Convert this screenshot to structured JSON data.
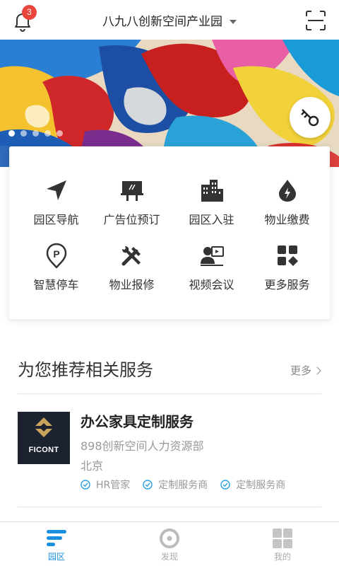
{
  "header": {
    "notification_count": "3",
    "park_name": "八九八创新空间产业园"
  },
  "banner": {
    "slide_count": 5,
    "active_slide": 1
  },
  "services": [
    {
      "label": "园区导航",
      "icon": "navigation-arrow-icon"
    },
    {
      "label": "广告位预订",
      "icon": "billboard-icon"
    },
    {
      "label": "园区入驻",
      "icon": "buildings-icon"
    },
    {
      "label": "物业缴费",
      "icon": "utility-drop-icon"
    },
    {
      "label": "智慧停车",
      "icon": "parking-pin-icon"
    },
    {
      "label": "物业报修",
      "icon": "repair-tools-icon"
    },
    {
      "label": "视频会议",
      "icon": "video-conference-icon"
    },
    {
      "label": "更多服务",
      "icon": "more-grid-icon"
    }
  ],
  "recommend": {
    "title": "为您推荐相关服务",
    "more_label": "更多",
    "item": {
      "logo_text": "FICONT",
      "title": "办公家具定制服务",
      "provider": "898创新空间人力资源部",
      "city": "北京",
      "tags": [
        "HR管家",
        "定制服务商",
        "定制服务商"
      ]
    }
  },
  "tabbar": {
    "tabs": [
      {
        "label": "园区",
        "active": true
      },
      {
        "label": "发现",
        "active": false
      },
      {
        "label": "我的",
        "active": false
      }
    ]
  },
  "colors": {
    "accent": "#1a8fe0",
    "badge": "#e8453c",
    "tag_check": "#2aa3e0"
  }
}
